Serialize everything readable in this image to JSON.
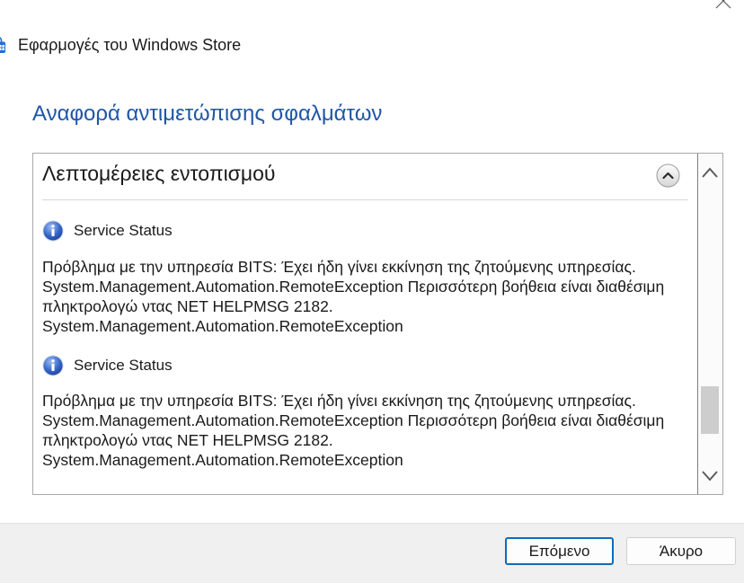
{
  "window": {
    "title": "Εφαρμογές του Windows Store",
    "title_icon": "windows-store-icon",
    "close_icon": "close-icon"
  },
  "report": {
    "heading": "Αναφορά αντιμετώπισης σφαλμάτων"
  },
  "details": {
    "section_title": "Λεπτομέρειες εντοπισμού",
    "collapse_icon": "chevron-up-circle-icon",
    "items": [
      {
        "icon": "info-icon",
        "title": "Service Status",
        "lines": [
          "Πρόβλημα με την υπηρεσία BITS: Έχει ήδη γίνει εκκίνηση της ζητούμενης υπηρεσίας.",
          "System.Management.Automation.RemoteException Περισσότερη βοήθεια είναι διαθέσιμη",
          "πληκτρολογώ ντας NET HELPMSG 2182.",
          "System.Management.Automation.RemoteException"
        ]
      },
      {
        "icon": "info-icon",
        "title": "Service Status",
        "lines": [
          "Πρόβλημα με την υπηρεσία BITS: Έχει ήδη γίνει εκκίνηση της ζητούμενης υπηρεσίας.",
          "System.Management.Automation.RemoteException Περισσότερη βοήθεια είναι διαθέσιμη",
          "πληκτρολογώ ντας NET HELPMSG 2182.",
          "System.Management.Automation.RemoteException"
        ]
      }
    ]
  },
  "scrollbar": {
    "up_icon": "chevron-up-icon",
    "down_icon": "chevron-down-icon"
  },
  "footer": {
    "next_label": "Επόμενο",
    "cancel_label": "Άκυρο"
  },
  "colors": {
    "heading": "#1f56a6",
    "default_button_border": "#0f6cbd",
    "info_icon": "#3566c8",
    "footer_background": "#f0f0f0",
    "scroll_thumb": "#cdcdcd"
  }
}
